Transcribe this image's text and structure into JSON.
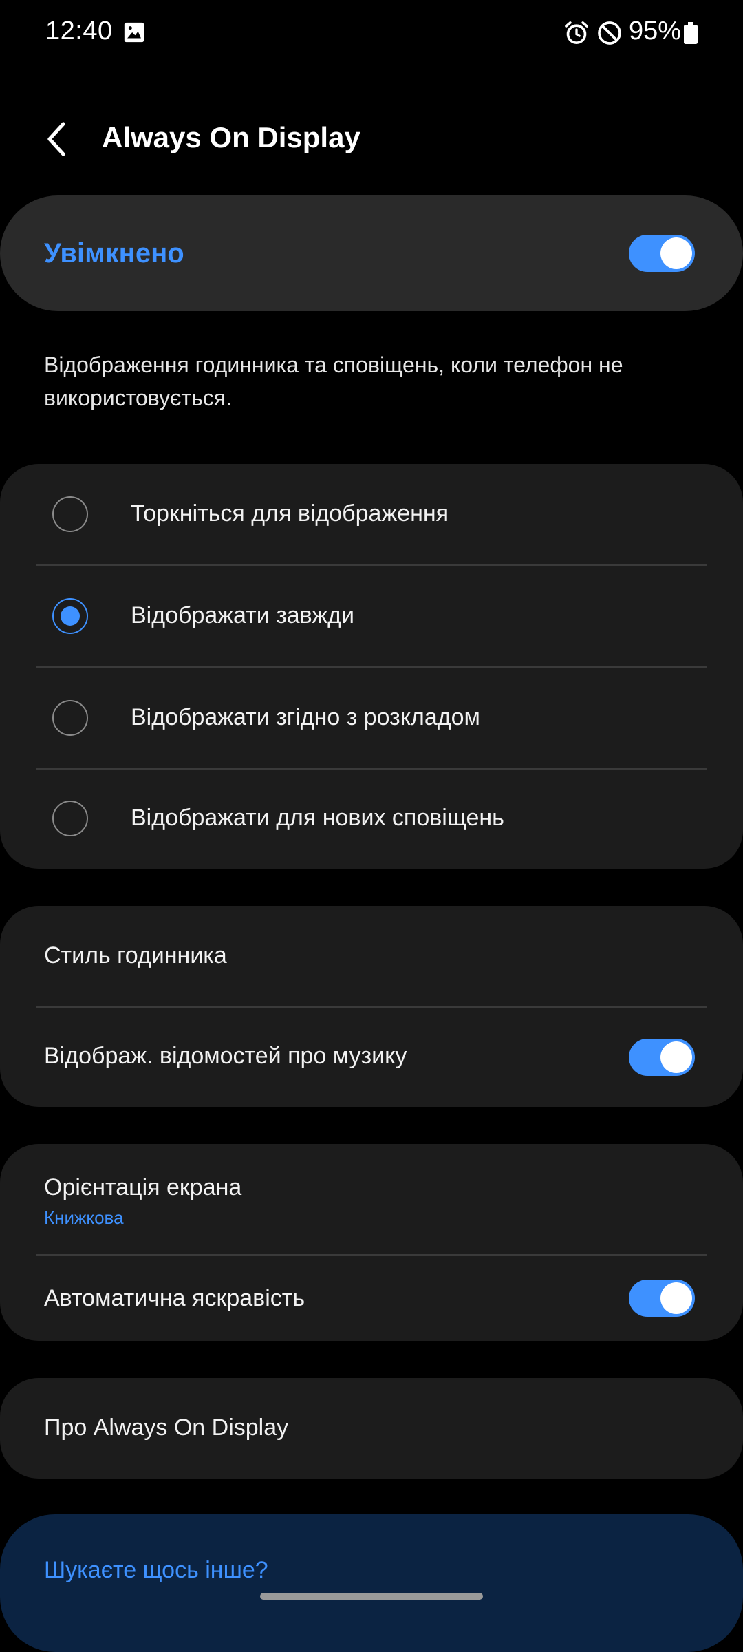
{
  "status_bar": {
    "time": "12:40",
    "battery": "95%",
    "icons": [
      "gallery-icon",
      "alarm-icon",
      "do-not-disturb-icon",
      "battery-icon"
    ]
  },
  "header": {
    "title": "Always On Display",
    "back_icon": "chevron-left-icon"
  },
  "master_switch": {
    "label": "Увімкнено",
    "on": true
  },
  "description": "Відображення годинника та сповіщень, коли телефон не використовується.",
  "display_modes": {
    "selected_index": 1,
    "options": [
      "Торкніться для відображення",
      "Відображати завжди",
      "Відображати згідно з розкладом",
      "Відображати для нових сповіщень"
    ]
  },
  "style_section": {
    "clock_style": "Стиль годинника",
    "music_info": "Відображ. відомостей про музику",
    "music_info_on": true
  },
  "screen_section": {
    "orientation_label": "Орієнтація екрана",
    "orientation_value": "Книжкова",
    "auto_brightness": "Автоматична яскравість",
    "auto_brightness_on": true
  },
  "about": {
    "label": "Про Always On Display"
  },
  "search_more": {
    "label": "Шукаєте щось інше?"
  },
  "colors": {
    "accent": "#3e91ff",
    "background": "#000000",
    "card": "#1c1c1c",
    "search_card": "#0b2342"
  }
}
